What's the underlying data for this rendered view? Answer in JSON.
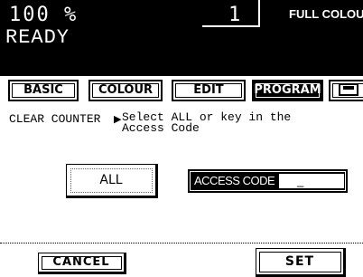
{
  "header": {
    "quantity": "100 %",
    "copy_count": "1",
    "mode": "FULL COLOUR",
    "status": "READY"
  },
  "tabs": [
    {
      "label": "BASIC"
    },
    {
      "label": "COLOUR"
    },
    {
      "label": "EDIT"
    },
    {
      "label": "PROGRAM",
      "active": true
    },
    {
      "icon": "counter-icon"
    }
  ],
  "message": {
    "left": "CLEAR COUNTER",
    "arrow": "▶",
    "line1": "Select ALL or key in the",
    "line2": "Access Code"
  },
  "buttons": {
    "all": "ALL",
    "access_code_label": "ACCESS CODE",
    "access_code_value": "_",
    "cancel": "CANCEL",
    "set": "SET"
  }
}
